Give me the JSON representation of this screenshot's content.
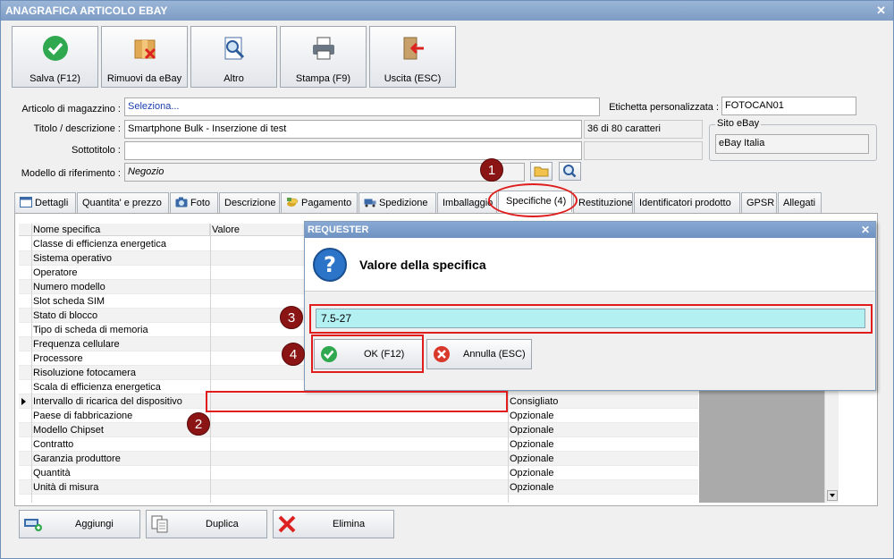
{
  "window": {
    "title": "ANAGRAFICA ARTICOLO EBAY",
    "close": "✕"
  },
  "toolbar": [
    {
      "label": "Salva (F12)",
      "icon": "save-check-icon"
    },
    {
      "label": "Rimuovi da eBay",
      "icon": "remove-box-icon"
    },
    {
      "label": "Altro",
      "icon": "magnifier-icon"
    },
    {
      "label": "Stampa (F9)",
      "icon": "printer-icon"
    },
    {
      "label": "Uscita (ESC)",
      "icon": "exit-door-icon"
    }
  ],
  "form": {
    "articolo_label": "Articolo di magazzino :",
    "articolo_value": "Seleziona...",
    "etichetta_label": "Etichetta personalizzata :",
    "etichetta_value": "FOTOCAN01",
    "titolo_label": "Titolo / descrizione :",
    "titolo_value": "Smartphone Bulk - Inserzione di test",
    "titolo_counter": "36 di 80 caratteri",
    "sito_label": "Sito eBay",
    "sito_value": "eBay Italia",
    "sottotitolo_label": "Sottotitolo :",
    "sottotitolo_value": "",
    "modello_label": "Modello di riferimento :",
    "modello_value": "Negozio"
  },
  "tabs": [
    {
      "label": "Dettagli",
      "icon": "window-icon"
    },
    {
      "label": "Quantita' e prezzo",
      "icon": ""
    },
    {
      "label": "Foto",
      "icon": "camera-icon"
    },
    {
      "label": "Descrizione",
      "icon": ""
    },
    {
      "label": "Pagamento",
      "icon": "coins-icon"
    },
    {
      "label": "Spedizione",
      "icon": "truck-icon"
    },
    {
      "label": "Imballaggio",
      "icon": ""
    },
    {
      "label": "Specifiche (4)",
      "icon": ""
    },
    {
      "label": "Restituzione",
      "icon": ""
    },
    {
      "label": "Identificatori prodotto",
      "icon": ""
    },
    {
      "label": "GPSR",
      "icon": ""
    },
    {
      "label": "Allegati",
      "icon": ""
    }
  ],
  "grid": {
    "headers": [
      "Nome specifica",
      "Valore"
    ],
    "rows": [
      {
        "name": "Classe di efficienza energetica",
        "type": ""
      },
      {
        "name": "Sistema operativo",
        "type": ""
      },
      {
        "name": "Operatore",
        "type": ""
      },
      {
        "name": "Numero modello",
        "type": ""
      },
      {
        "name": "Slot scheda SIM",
        "type": ""
      },
      {
        "name": "Stato di blocco",
        "type": ""
      },
      {
        "name": "Tipo di scheda di memoria",
        "type": ""
      },
      {
        "name": "Frequenza cellulare",
        "type": ""
      },
      {
        "name": "Processore",
        "type": ""
      },
      {
        "name": "Risoluzione fotocamera",
        "type": ""
      },
      {
        "name": "Scala di efficienza energetica",
        "type": ""
      },
      {
        "name": "Intervallo di ricarica del dispositivo",
        "type": "Consigliato"
      },
      {
        "name": "Paese di fabbricazione",
        "type": "Opzionale"
      },
      {
        "name": "Modello Chipset",
        "type": "Opzionale"
      },
      {
        "name": "Contratto",
        "type": "Opzionale"
      },
      {
        "name": "Garanzia produttore",
        "type": "Opzionale"
      },
      {
        "name": "Quantità",
        "type": "Opzionale"
      },
      {
        "name": "Unità di misura",
        "type": "Opzionale"
      }
    ]
  },
  "bottom": {
    "add": "Aggiungi",
    "duplicate": "Duplica",
    "delete": "Elimina"
  },
  "dialog": {
    "title": "REQUESTER",
    "close": "✕",
    "heading": "Valore della specifica",
    "input_value": "7.5-27",
    "ok": "OK (F12)",
    "cancel": "Annulla (ESC)"
  },
  "callouts": [
    "1",
    "2",
    "3",
    "4"
  ],
  "colors": {
    "accent_red": "#e01c1c",
    "callout": "#8b1414",
    "input_highlight": "#b3f0f2"
  }
}
